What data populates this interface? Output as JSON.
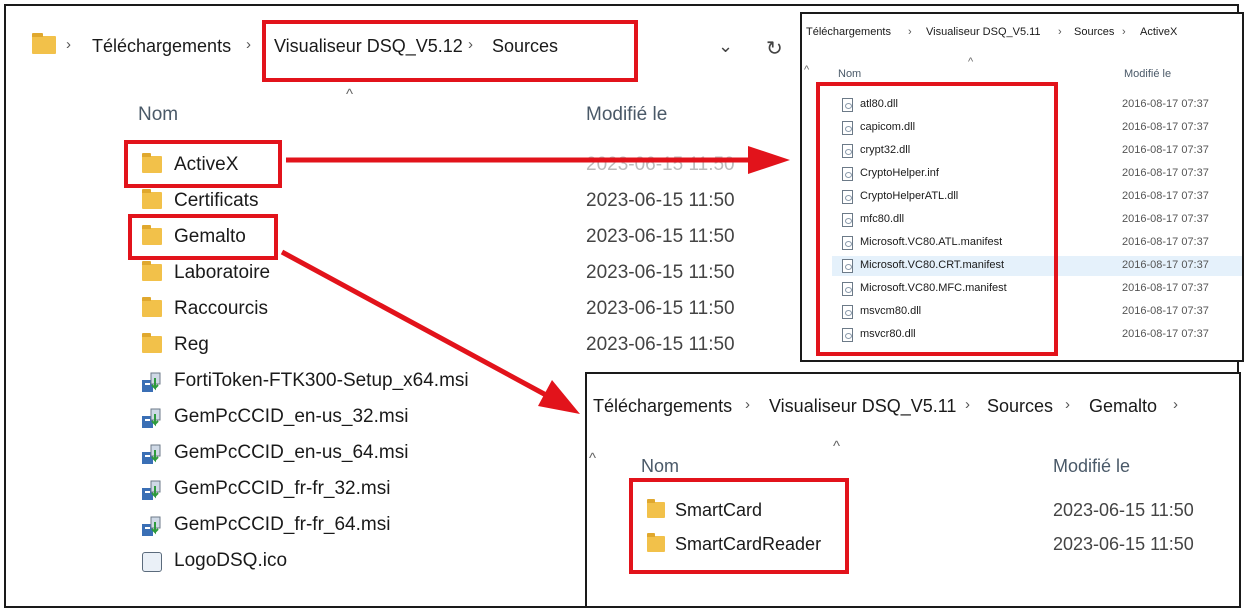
{
  "main": {
    "breadcrumb": [
      "Téléchargements",
      "Visualiseur DSQ_V5.12",
      "Sources"
    ],
    "column_name": "Nom",
    "column_modified": "Modifié le",
    "folders": [
      {
        "name": "ActiveX",
        "date": "2023-06-15 11:50"
      },
      {
        "name": "Certificats",
        "date": "2023-06-15 11:50"
      },
      {
        "name": "Gemalto",
        "date": "2023-06-15 11:50"
      },
      {
        "name": "Laboratoire",
        "date": "2023-06-15 11:50"
      },
      {
        "name": "Raccourcis",
        "date": "2023-06-15 11:50"
      },
      {
        "name": "Reg",
        "date": "2023-06-15 11:50"
      }
    ],
    "files": [
      {
        "name": "FortiToken-FTK300-Setup_x64.msi",
        "icon": "msi-installer-icon"
      },
      {
        "name": "GemPcCCID_en-us_32.msi",
        "icon": "msi-installer-icon"
      },
      {
        "name": "GemPcCCID_en-us_64.msi",
        "icon": "msi-installer-icon"
      },
      {
        "name": "GemPcCCID_fr-fr_32.msi",
        "icon": "msi-installer-icon"
      },
      {
        "name": "GemPcCCID_fr-fr_64.msi",
        "icon": "msi-installer-icon"
      },
      {
        "name": "LogoDSQ.ico",
        "icon": "ico-file-icon"
      }
    ],
    "chevron_glyph": "⌄",
    "refresh_glyph": "↻",
    "sort_glyph": "^"
  },
  "activex": {
    "breadcrumb": [
      "Téléchargements",
      "Visualiseur DSQ_V5.11",
      "Sources",
      "ActiveX"
    ],
    "column_name": "Nom",
    "column_modified": "Modifié le",
    "files": [
      {
        "name": "atl80.dll",
        "date": "2016-08-17 07:37"
      },
      {
        "name": "capicom.dll",
        "date": "2016-08-17 07:37"
      },
      {
        "name": "crypt32.dll",
        "date": "2016-08-17 07:37"
      },
      {
        "name": "CryptoHelper.inf",
        "date": "2016-08-17 07:37"
      },
      {
        "name": "CryptoHelperATL.dll",
        "date": "2016-08-17 07:37"
      },
      {
        "name": "mfc80.dll",
        "date": "2016-08-17 07:37"
      },
      {
        "name": "Microsoft.VC80.ATL.manifest",
        "date": "2016-08-17 07:37"
      },
      {
        "name": "Microsoft.VC80.CRT.manifest",
        "date": "2016-08-17 07:37"
      },
      {
        "name": "Microsoft.VC80.MFC.manifest",
        "date": "2016-08-17 07:37"
      },
      {
        "name": "msvcm80.dll",
        "date": "2016-08-17 07:37"
      },
      {
        "name": "msvcr80.dll",
        "date": "2016-08-17 07:37"
      }
    ]
  },
  "gemalto": {
    "breadcrumb": [
      "Téléchargements",
      "Visualiseur DSQ_V5.11",
      "Sources",
      "Gemalto"
    ],
    "column_name": "Nom",
    "column_modified": "Modifié le",
    "folders": [
      {
        "name": "SmartCard",
        "date": "2023-06-15 11:50"
      },
      {
        "name": "SmartCardReader",
        "date": "2023-06-15 11:50"
      }
    ]
  },
  "colors": {
    "highlight_red": "#e2131b",
    "folder_yellow": "#f2c14a",
    "header_text": "#4a5968"
  }
}
